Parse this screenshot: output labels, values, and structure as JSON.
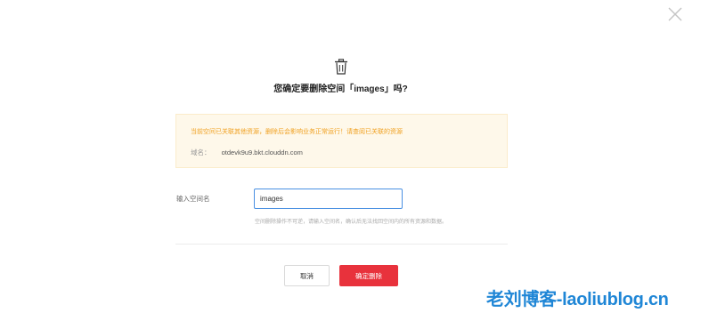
{
  "dialog": {
    "title": "您确定要删除空间「images」吗?",
    "warning": "当前空间已关联其他资源，删除后会影响业务正常运行！请查阅已关联的资源",
    "domain_label": "域名：",
    "domain_value": "otdevk9u9.bkt.clouddn.com",
    "field_label": "输入空间名",
    "input_value": "images",
    "hint": "空间删除操作不可逆，请输入空间名，确认后无法找回空间内的所有资源和数据。",
    "cancel_label": "取消",
    "confirm_label": "确定删除"
  },
  "watermark": "老刘博客-laoliublog.cn",
  "colors": {
    "warning_text": "#f0a020",
    "warning_bg": "#fef8ea",
    "danger": "#e8323c",
    "input_border": "#4a90e2",
    "watermark": "#1f86d6"
  },
  "icons": [
    "close-icon",
    "trash-icon"
  ]
}
